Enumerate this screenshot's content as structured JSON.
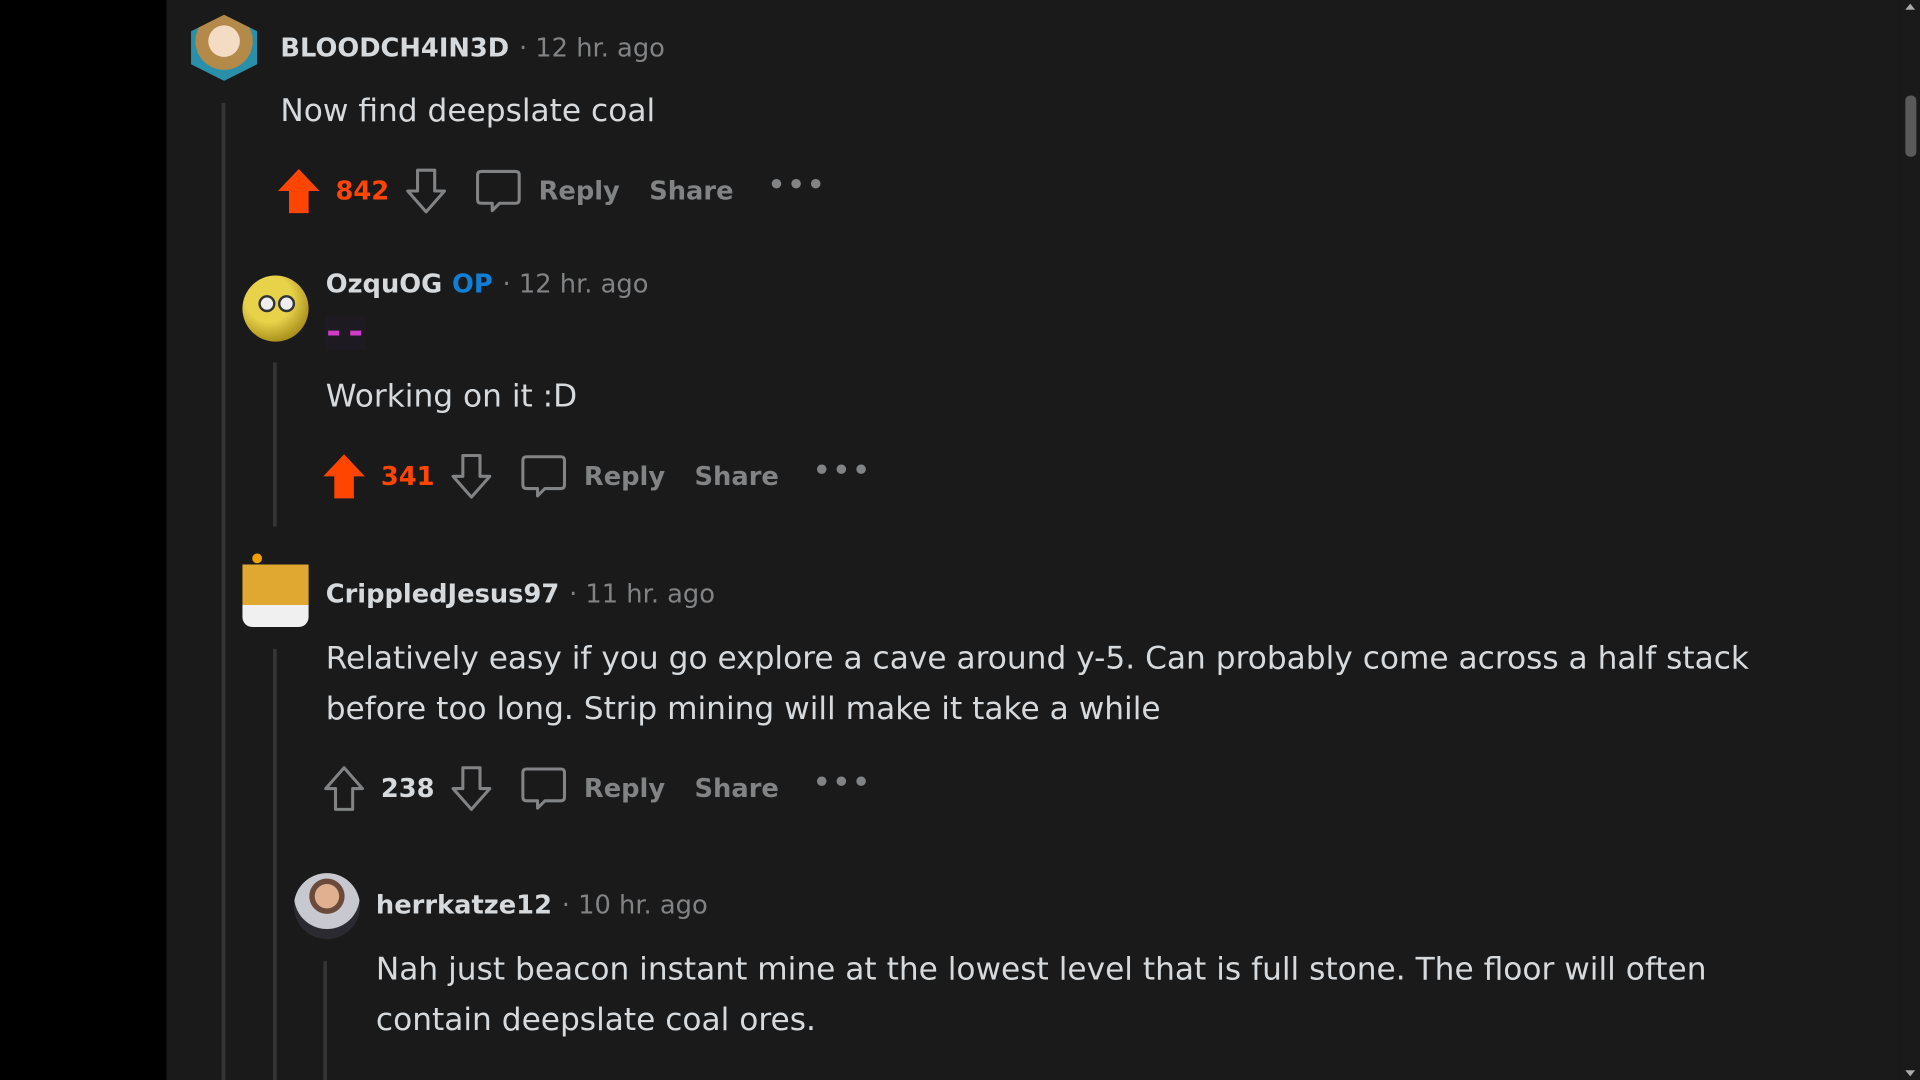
{
  "colors": {
    "background": "#1a1a1b",
    "upvoted": "#ff4500",
    "op_badge": "#0f7fd6",
    "text": "#d7dadc",
    "muted": "#818384"
  },
  "comments": [
    {
      "username": "BLOODCH4IN3D",
      "time": "· 12 hr. ago",
      "body": "Now find deepslate coal",
      "score": "842",
      "upvoted": true,
      "reply": "Reply",
      "share": "Share",
      "more": "•••"
    },
    {
      "username": "OzquOG",
      "badge": "OP",
      "time": "· 12 hr. ago",
      "flair_icon": "enderman-flair-icon",
      "body": "Working on it :D",
      "score": "341",
      "upvoted": true,
      "reply": "Reply",
      "share": "Share",
      "more": "•••"
    },
    {
      "username": "CrippledJesus97",
      "time": "· 11 hr. ago",
      "body": "Relatively easy if you go explore a cave around y-5. Can probably come across a half stack before too long. Strip mining will make it take a while",
      "score": "238",
      "upvoted": false,
      "reply": "Reply",
      "share": "Share",
      "more": "•••"
    },
    {
      "username": "herrkatze12",
      "time": "· 10 hr. ago",
      "body": "Nah just beacon instant mine at the lowest level that is full stone. The floor will often contain deepslate coal ores."
    }
  ]
}
